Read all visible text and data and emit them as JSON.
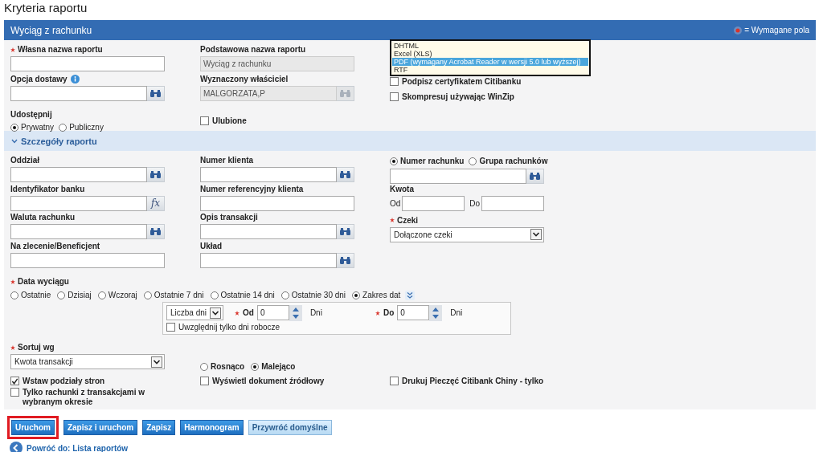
{
  "title": "Kryteria raportu",
  "panel": {
    "title": "Wyciąg z rachunku",
    "legend": "= Wymagane pola"
  },
  "general": {
    "columns": [
      [
        {
          "kind": "field",
          "label": "Własna nazwa raportu",
          "required": true,
          "input": {
            "kind": "text"
          }
        },
        {
          "kind": "field",
          "label": "Opcja dostawy",
          "info": true,
          "input": {
            "kind": "lookup"
          }
        },
        {
          "kind": "radios",
          "label": "Udostępnij",
          "options": [
            {
              "label": "Prywatny",
              "selected": true
            },
            {
              "label": "Publiczny",
              "selected": false
            }
          ]
        }
      ],
      [
        {
          "kind": "field",
          "label": "Podstawowa nazwa raportu",
          "input": {
            "kind": "readonly",
            "value": "Wyciąg z rachunku"
          }
        },
        {
          "kind": "field",
          "label": "Wyznaczony właściciel",
          "input": {
            "kind": "readonly-lookup",
            "value": "MALGORZATA,P"
          }
        },
        {
          "kind": "checkbox",
          "label": "Ulubione",
          "checked": false
        }
      ],
      [
        {
          "kind": "listbox",
          "options": [
            {
              "label": "DHTML",
              "selected": false
            },
            {
              "label": "Excel (XLS)",
              "selected": false
            },
            {
              "label": "PDF (wymagany Acrobat Reader w wersji 5.0 lub wyższej)",
              "selected": true
            },
            {
              "label": "RTF",
              "selected": false
            }
          ]
        },
        {
          "kind": "checkbox",
          "label": "Podpisz certyfikatem Citibanku",
          "checked": false
        },
        {
          "kind": "checkbox",
          "label": "Skompresuj używając WinZip",
          "checked": false
        }
      ]
    ]
  },
  "details": {
    "title": "Szczegóły raportu",
    "expanded": true,
    "columns": [
      [
        {
          "kind": "field",
          "label": "Oddział",
          "input": {
            "kind": "lookup"
          }
        },
        {
          "kind": "field",
          "label": "Identyfikator banku",
          "input": {
            "kind": "fx",
            "button_label": "fx"
          }
        },
        {
          "kind": "field",
          "label": "Waluta rachunku",
          "input": {
            "kind": "lookup"
          }
        },
        {
          "kind": "field",
          "label": "Na zlecenie/Beneficjent",
          "input": {
            "kind": "text"
          }
        }
      ],
      [
        {
          "kind": "field",
          "label": "Numer klienta",
          "input": {
            "kind": "lookup"
          }
        },
        {
          "kind": "field",
          "label": "Numer referencyjny klienta",
          "input": {
            "kind": "text"
          }
        },
        {
          "kind": "field",
          "label": "Opis transakcji",
          "input": {
            "kind": "lookup"
          }
        },
        {
          "kind": "field",
          "label": "Układ",
          "input": {
            "kind": "lookup"
          }
        }
      ],
      [
        {
          "kind": "radio-field",
          "options": [
            {
              "label": "Numer rachunku",
              "selected": true
            },
            {
              "label": "Grupa rachunków",
              "selected": false
            }
          ],
          "input": {
            "kind": "lookup"
          }
        },
        {
          "kind": "range",
          "label": "Kwota",
          "from_label": "Od",
          "to_label": "Do"
        },
        {
          "kind": "field",
          "label": "Czeki",
          "required": true,
          "input": {
            "kind": "select",
            "value": "Dołączone czeki"
          }
        }
      ]
    ],
    "date": {
      "label": "Data wyciągu",
      "required": true,
      "options": [
        {
          "label": "Ostatnie",
          "selected": false
        },
        {
          "label": "Dzisiaj",
          "selected": false
        },
        {
          "label": "Wczoraj",
          "selected": false
        },
        {
          "label": "Ostatnie 7 dni",
          "selected": false
        },
        {
          "label": "Ostatnie 14 dni",
          "selected": false
        },
        {
          "label": "Ostatnie 30 dni",
          "selected": false
        },
        {
          "label": "Zakres dat",
          "selected": true
        }
      ],
      "range": {
        "unit_select": "Liczba dni",
        "from_label": "Od",
        "from_value": "0",
        "from_unit": "Dni",
        "to_label": "Do",
        "to_value": "0",
        "to_unit": "Dni",
        "workdays": {
          "label": "Uwzględnij tylko dni robocze",
          "checked": false
        }
      }
    },
    "sort": {
      "label": "Sortuj wg",
      "required": true,
      "value": "Kwota transakcji",
      "order": [
        {
          "label": "Rosnąco",
          "selected": false
        },
        {
          "label": "Malejąco",
          "selected": true
        }
      ]
    },
    "flags": [
      [
        {
          "label": "Wstaw podziały stron",
          "checked": true
        },
        {
          "label": "Tylko rachunki z transakcjami w wybranym okresie",
          "checked": false
        }
      ],
      [
        {
          "label": "Wyświetl dokument źródłowy",
          "checked": false
        }
      ],
      [
        {
          "label": "Drukuj Pieczęć Citibank Chiny - tylko",
          "checked": false
        }
      ]
    ]
  },
  "buttons": [
    {
      "label": "Uruchom",
      "kind": "primary",
      "highlighted": true
    },
    {
      "label": "Zapisz i uruchom",
      "kind": "primary",
      "highlighted": false
    },
    {
      "label": "Zapisz",
      "kind": "primary",
      "highlighted": false
    },
    {
      "label": "Harmonogram",
      "kind": "primary",
      "highlighted": false
    },
    {
      "label": "Przywróć domyślne",
      "kind": "secondary",
      "highlighted": false
    }
  ],
  "back_link": "Powróć do: Lista raportów"
}
